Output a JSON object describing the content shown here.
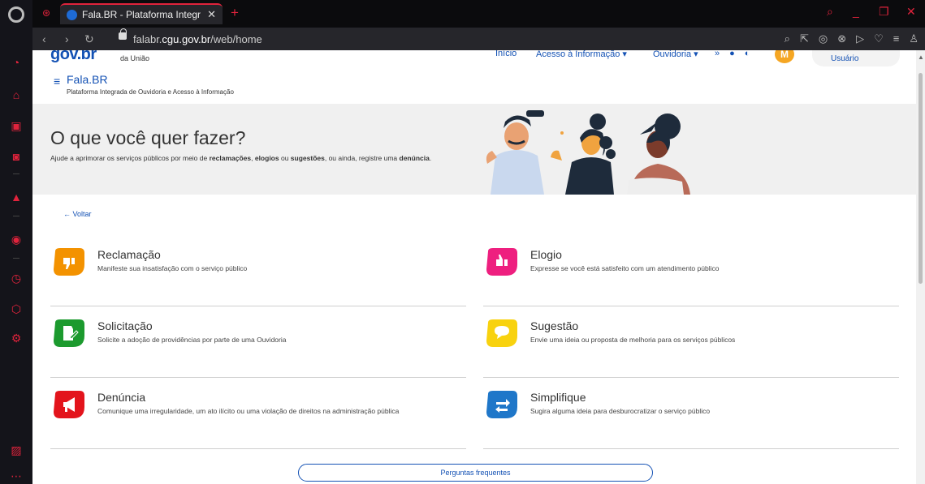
{
  "browser": {
    "tab_title": "Fala.BR - Plataforma Integr",
    "url_prefix": "falabr.",
    "url_domain": "cgu.gov.br",
    "url_path": "/web/home"
  },
  "header": {
    "logo": "gov.br",
    "org_name": "da União",
    "nav": [
      "Início",
      "Acesso à Informação ▾",
      "Ouvidoria ▾"
    ],
    "avatar_letter": "M",
    "user_label": "Usuário",
    "app_name": "Fala.BR",
    "app_desc": "Plataforma Integrada de Ouvidoria e Acesso à Informação"
  },
  "hero": {
    "title": "O que você quer fazer?",
    "subtitle_parts": [
      "Ajude a aprimorar os serviços públicos por meio de ",
      "reclamações",
      ", ",
      "elogios",
      " ou ",
      "sugestões",
      ", ou ainda, registre uma ",
      "denúncia",
      "."
    ]
  },
  "back_label": "← Voltar",
  "options": [
    {
      "title": "Reclamação",
      "desc": "Manifeste sua insatisfação com o serviço público",
      "color": "#f39200"
    },
    {
      "title": "Elogio",
      "desc": "Expresse se você está satisfeito com um atendimento público",
      "color": "#ee1f7f"
    },
    {
      "title": "Solicitação",
      "desc": "Solicite a adoção de providências por parte de uma Ouvidoria",
      "color": "#1c9a2e"
    },
    {
      "title": "Sugestão",
      "desc": "Envie uma ideia ou proposta de melhoria para os serviços públicos",
      "color": "#f8d20f"
    },
    {
      "title": "Denúncia",
      "desc": "Comunique uma irregularidade, um ato ilícito ou uma violação de direitos na administração pública",
      "color": "#e3141c"
    },
    {
      "title": "Simplifique",
      "desc": "Sugira alguma ideia para desburocratizar o serviço público",
      "color": "#1f77c9"
    }
  ],
  "faq_label": "Perguntas frequentes"
}
